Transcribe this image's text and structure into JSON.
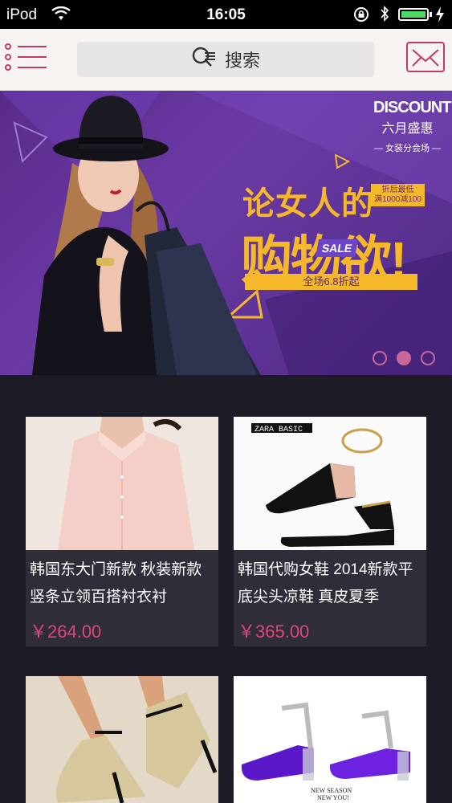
{
  "status_bar": {
    "carrier": "iPod",
    "time": "16:05"
  },
  "header": {
    "search_label": "搜索",
    "menu_icon": "menu-icon",
    "mail_icon": "mail-icon"
  },
  "banner": {
    "badge_title": "DISCOUNT",
    "badge_subtitle": "六月盛惠",
    "badge_note": "— 女装分会场 —",
    "headline_line1": "论女人的",
    "headline_line2": "购物欲!",
    "sale_tag": "SALE",
    "promo_tag": "折后最低\n满1000减100",
    "promo_bar": "全场6.8折起",
    "active_slide": 2,
    "slides_total": 3
  },
  "products": [
    {
      "name": "韩国东大门新款 秋装新款 竖条立领百搭衬衣衬",
      "price": "￥264.00"
    },
    {
      "name": "韩国代购女鞋 2014新款平底尖头凉鞋 真皮夏季",
      "price": "￥365.00",
      "image_brand": "ZARA BASIC"
    },
    {
      "name": "",
      "price": ""
    },
    {
      "name": "",
      "price": "",
      "image_caption": "NEW SEASON\nNEW YOU!"
    }
  ],
  "colors": {
    "accent": "#c23a6a",
    "price": "#e0457b",
    "banner_bg": "#5a2a8a",
    "banner_text": "#f5b82a",
    "page_bg": "#1d1b25"
  }
}
